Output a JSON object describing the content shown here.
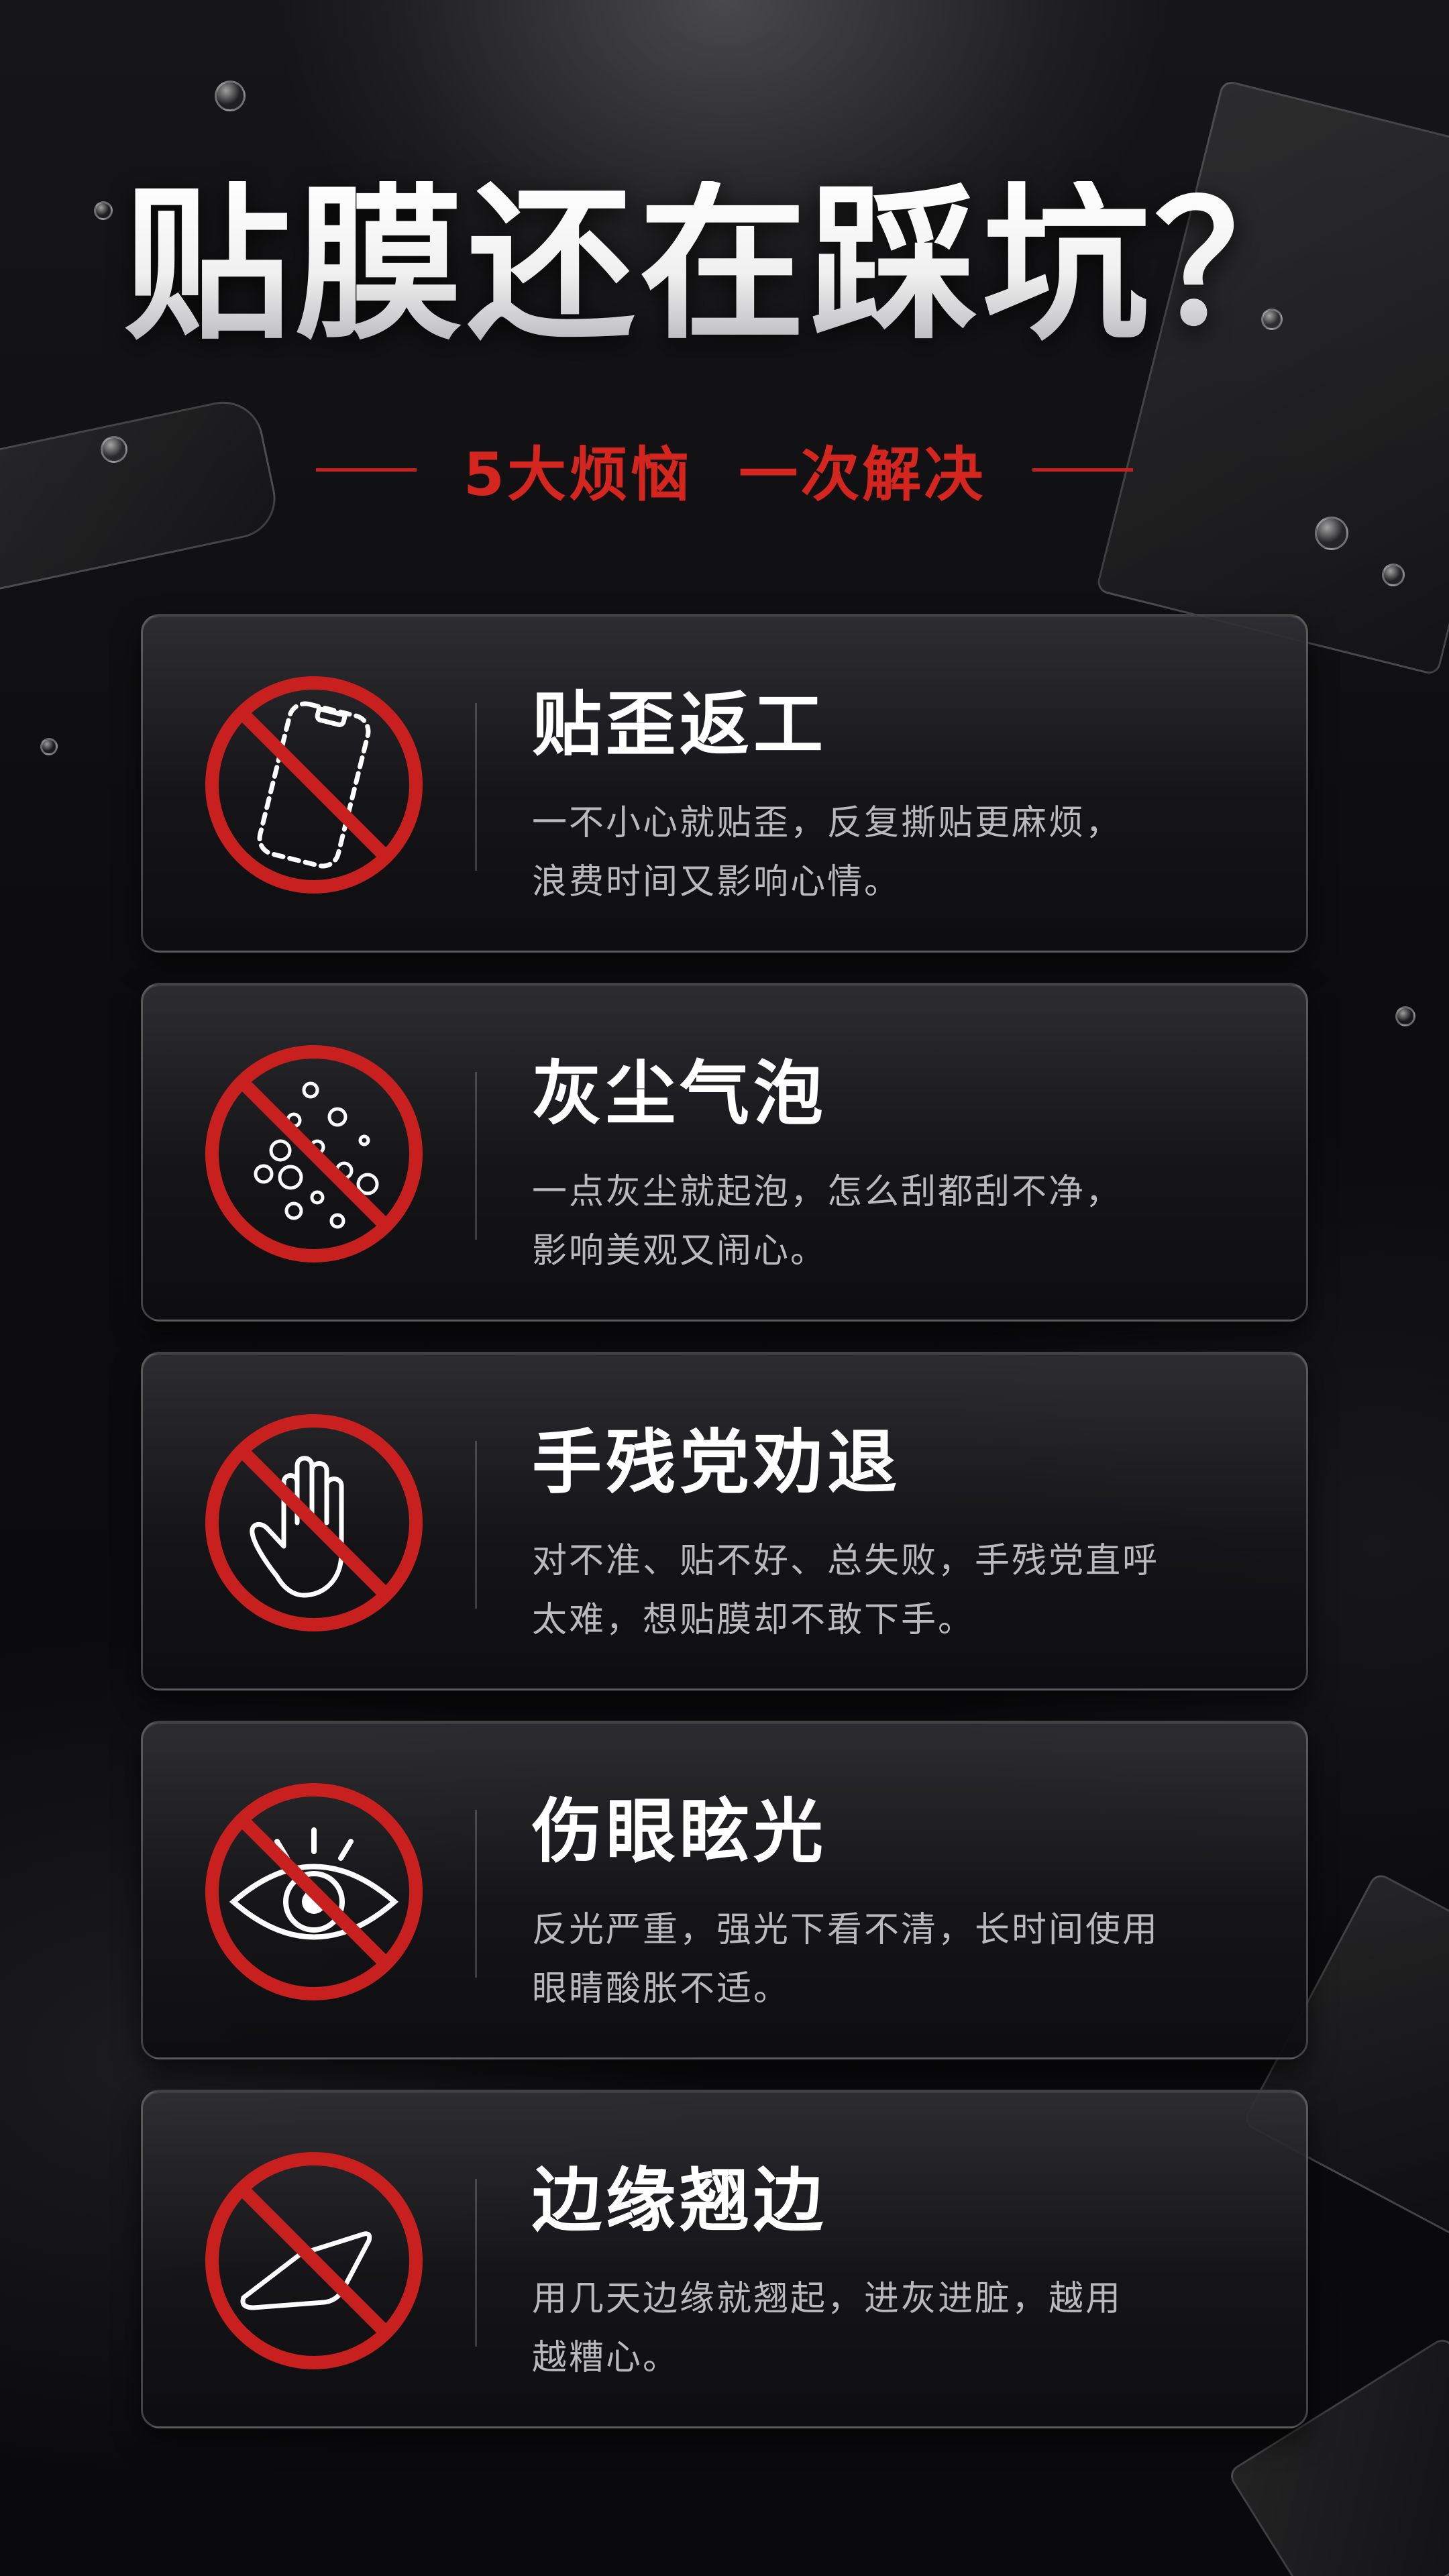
{
  "header": {
    "title": "贴膜还在踩坑？",
    "subtitle": "5大烦恼  一次解决"
  },
  "colors": {
    "accent_red": "#d4251f",
    "background": "#0b0b0d",
    "card_text": "#b9b9be"
  },
  "cards": [
    {
      "icon": "tilted-phone-icon",
      "title": "贴歪返工",
      "desc_line1": "一不小心就贴歪，反复撕贴更麻烦，",
      "desc_line2": "浪费时间又影响心情。"
    },
    {
      "icon": "dust-bubbles-icon",
      "title": "灰尘气泡",
      "desc_line1": "一点灰尘就起泡，怎么刮都刮不净，",
      "desc_line2": "影响美观又闹心。"
    },
    {
      "icon": "hand-icon",
      "title": "手残党劝退",
      "desc_line1": "对不准、贴不好、总失败，手残党直呼",
      "desc_line2": "太难，想贴膜却不敢下手。"
    },
    {
      "icon": "eye-glare-icon",
      "title": "伤眼眩光",
      "desc_line1": "反光严重，强光下看不清，长时间使用",
      "desc_line2": "眼睛酸胀不适。"
    },
    {
      "icon": "curled-edge-icon",
      "title": "边缘翘边",
      "desc_line1": "用几天边缘就翘起，进灰进脏，越用",
      "desc_line2": "越糟心。"
    }
  ]
}
